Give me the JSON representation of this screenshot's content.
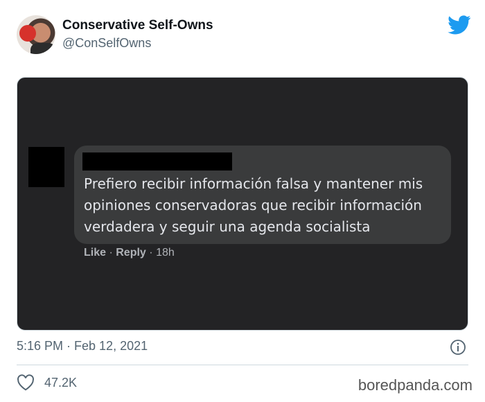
{
  "tweet": {
    "display_name": "Conservative Self-Owns",
    "handle": "@ConSelfOwns",
    "timestamp": "5:16 PM · Feb 12, 2021",
    "likes": "47.2K",
    "icons": [
      "twitter-bird-icon",
      "info-icon",
      "heart-icon"
    ],
    "brand_color": "#1d9bf0"
  },
  "screenshot": {
    "comment_text": "Prefiero recibir información falsa y mantener mis opiniones conservadoras que recibir información verdadera y seguir una agenda socialista",
    "like_label": "Like",
    "separator": "·",
    "reply_label": "Reply",
    "age": "18h"
  },
  "watermark": "boredpanda.com"
}
